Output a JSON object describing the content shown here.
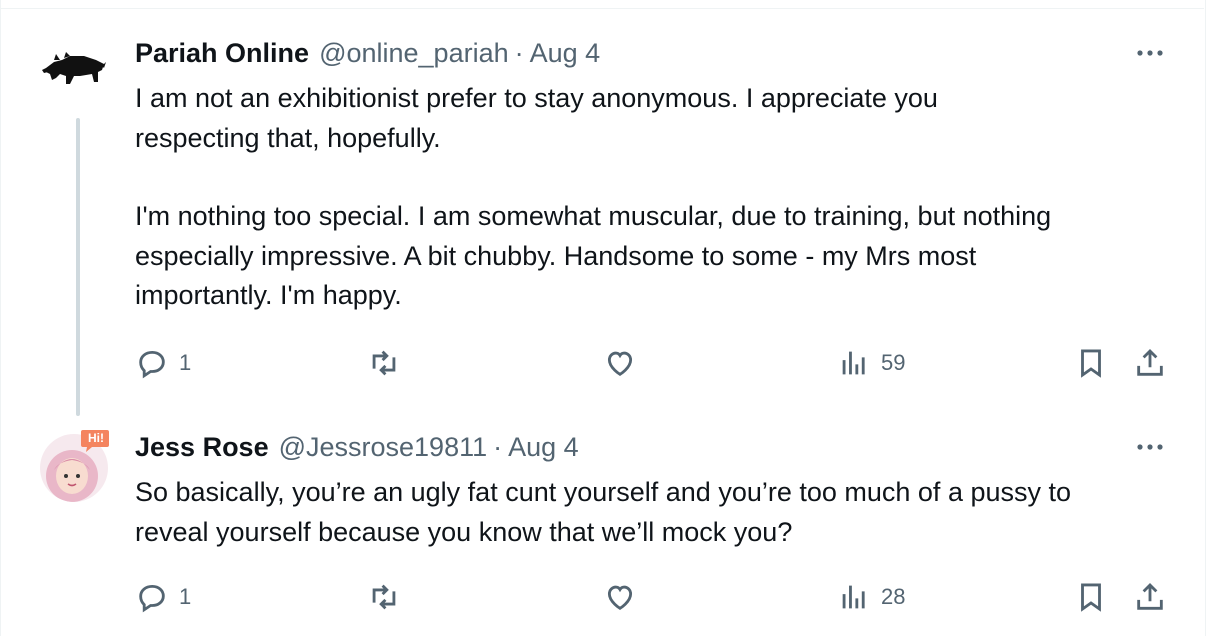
{
  "tweets": [
    {
      "name": "Pariah Online",
      "handle": "@online_pariah",
      "separator": "·",
      "date": "Aug 4",
      "text_lines": [
        "I am not an exhibitionist prefer to stay anonymous. I appreciate you",
        "respecting that, hopefully.",
        "I'm nothing too special. I am somewhat muscular, due to training, but nothing",
        "especially impressive. A bit chubby. Handsome to some - my Mrs most",
        "importantly. I'm happy."
      ],
      "replies": "1",
      "views": "59",
      "avatar_icon": "boar-silhouette-icon"
    },
    {
      "name": "Jess Rose",
      "handle": "@Jessrose19811",
      "separator": "·",
      "date": "Aug 4",
      "text_lines": [
        "So basically, you’re an ugly fat cunt yourself and you’re too much of a pussy to",
        "reveal yourself because you know that we’ll mock you?"
      ],
      "replies": "1",
      "views": "28",
      "avatar_icon": "cartoon-girl-avatar",
      "avatar_badge": "Hi!"
    }
  ],
  "colors": {
    "text": "#0f1419",
    "secondary": "#536471",
    "thread_line": "#cfd9de",
    "badge": "#f4845f"
  }
}
